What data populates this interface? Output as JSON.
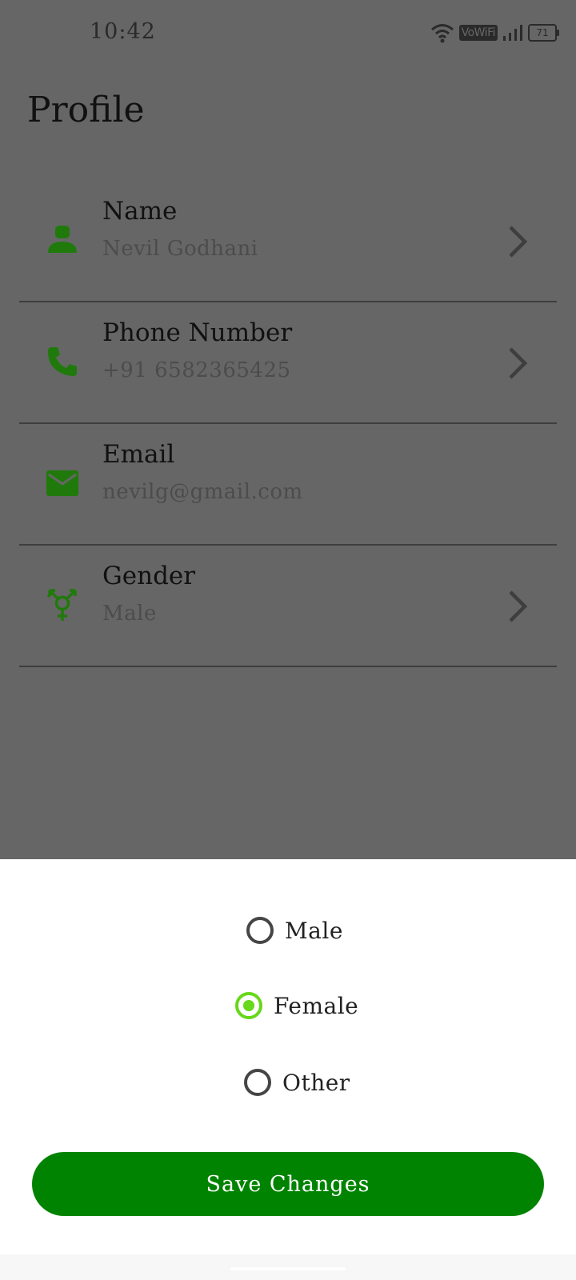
{
  "status_bar": {
    "time": "10:42",
    "network_badge": "VoWiFi",
    "battery": "71"
  },
  "page": {
    "title": "Profile"
  },
  "rows": [
    {
      "label": "Name",
      "value": "Nevil Godhani",
      "icon": "person-icon",
      "has_chevron": true
    },
    {
      "label": "Phone Number",
      "value": "+91 6582365425",
      "icon": "phone-icon",
      "has_chevron": true
    },
    {
      "label": "Email",
      "value": "nevilg@gmail.com",
      "icon": "email-icon",
      "has_chevron": false
    },
    {
      "label": "Gender",
      "value": "Male",
      "icon": "gender-icon",
      "has_chevron": true
    }
  ],
  "gender_sheet": {
    "options": [
      {
        "label": "Male",
        "selected": false
      },
      {
        "label": "Female",
        "selected": true
      },
      {
        "label": "Other",
        "selected": false
      }
    ],
    "save_label": "Save Changes"
  },
  "colors": {
    "accent_green": "#008300",
    "icon_green": "#1f7a0b",
    "radio_selected": "#67d81a",
    "overlay": "#666666"
  }
}
